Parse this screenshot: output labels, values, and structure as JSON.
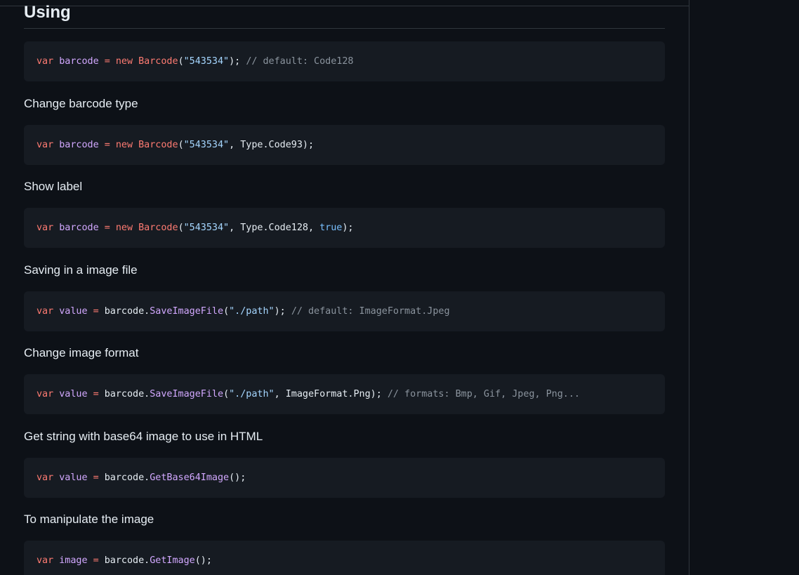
{
  "heading": "Using",
  "blocks": [
    {
      "code": {
        "t1": "var",
        "t2": " ",
        "t3": "barcode",
        "t4": " ",
        "t5": "=",
        "t6": " ",
        "t7": "new",
        "t8": " ",
        "t9": "Barcode",
        "t10": "(",
        "t11": "\"543534\"",
        "t12": "); ",
        "t13": "// default: Code128"
      }
    },
    {
      "label": "Change barcode type",
      "code": {
        "t1": "var",
        "t2": " ",
        "t3": "barcode",
        "t4": " ",
        "t5": "=",
        "t6": " ",
        "t7": "new",
        "t8": " ",
        "t9": "Barcode",
        "t10": "(",
        "t11": "\"543534\"",
        "t12": ", Type.Code93);"
      }
    },
    {
      "label": "Show label",
      "code": {
        "t1": "var",
        "t2": " ",
        "t3": "barcode",
        "t4": " ",
        "t5": "=",
        "t6": " ",
        "t7": "new",
        "t8": " ",
        "t9": "Barcode",
        "t10": "(",
        "t11": "\"543534\"",
        "t12": ", Type.Code128, ",
        "t13": "true",
        "t14": ");"
      }
    },
    {
      "label": "Saving in a image file",
      "code": {
        "t1": "var",
        "t2": " ",
        "t3": "value",
        "t4": " ",
        "t5": "=",
        "t6": " barcode.",
        "t7": "SaveImageFile",
        "t8": "(",
        "t9": "\"./path\"",
        "t10": "); ",
        "t11": "// default: ImageFormat.Jpeg"
      }
    },
    {
      "label": "Change image format",
      "code": {
        "t1": "var",
        "t2": " ",
        "t3": "value",
        "t4": " ",
        "t5": "=",
        "t6": " barcode.",
        "t7": "SaveImageFile",
        "t8": "(",
        "t9": "\"./path\"",
        "t10": ", ImageFormat.Png); ",
        "t11": "// formats: Bmp, Gif, Jpeg, Png..."
      }
    },
    {
      "label": "Get string with base64 image to use in HTML",
      "code": {
        "t1": "var",
        "t2": " ",
        "t3": "value",
        "t4": " ",
        "t5": "=",
        "t6": " barcode.",
        "t7": "GetBase64Image",
        "t8": "();"
      }
    },
    {
      "label": "To manipulate the image",
      "code": {
        "t1": "var",
        "t2": " ",
        "t3": "image",
        "t4": " ",
        "t5": "=",
        "t6": " barcode.",
        "t7": "GetImage",
        "t8": "();"
      }
    }
  ],
  "colors": {
    "background": "#0d1117",
    "code_background": "#161b22",
    "keyword": "#ff7b72",
    "variable": "#d2a8ff",
    "string": "#a5d6ff",
    "boolean": "#79c0ff",
    "comment": "#8b949e"
  }
}
